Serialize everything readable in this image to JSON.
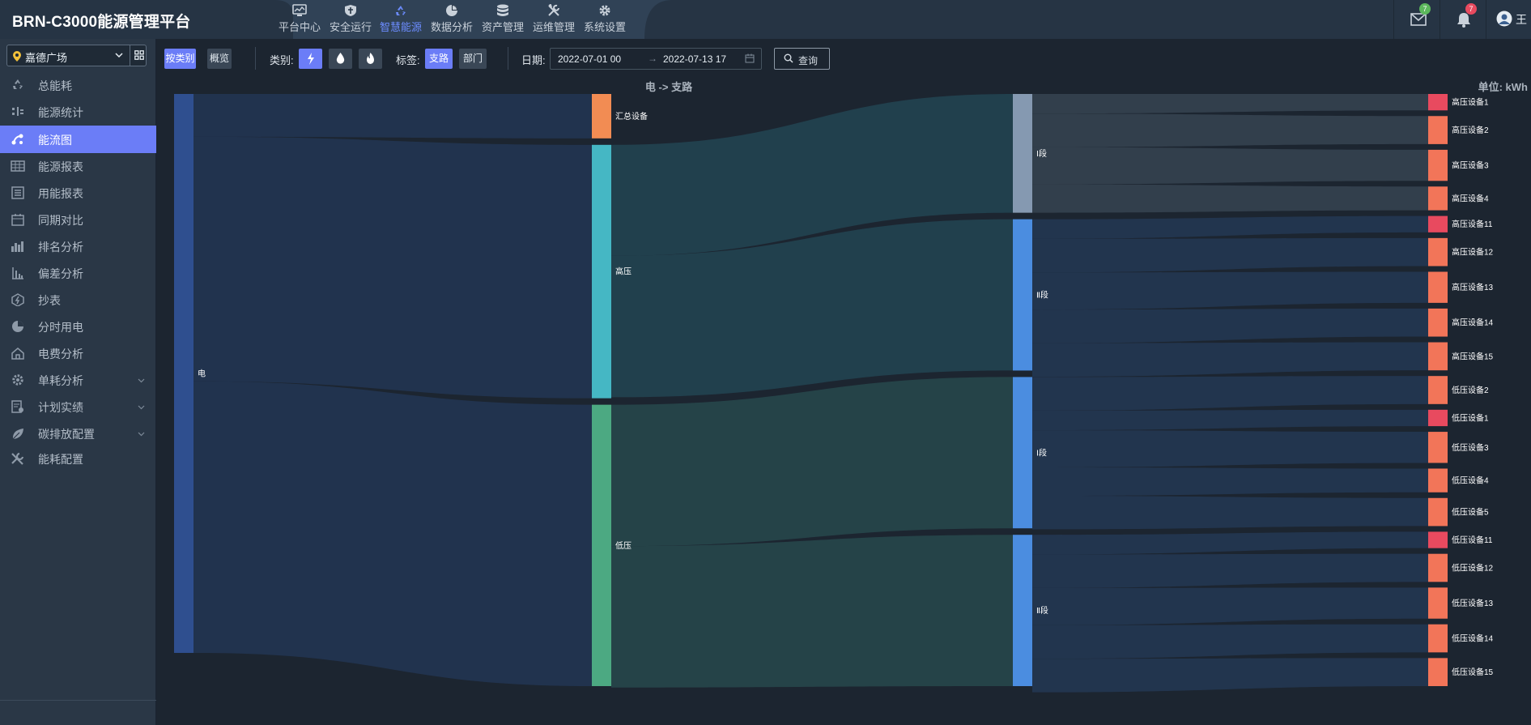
{
  "app": {
    "title": "BRN-C3000能源管理平台"
  },
  "topnav": [
    {
      "label": "平台中心",
      "icon": "monitor-icon",
      "active": false
    },
    {
      "label": "安全运行",
      "icon": "shield-icon",
      "active": false
    },
    {
      "label": "智慧能源",
      "icon": "recycle-icon",
      "active": true
    },
    {
      "label": "数据分析",
      "icon": "pie-chart-icon",
      "active": false
    },
    {
      "label": "资产管理",
      "icon": "database-icon",
      "active": false
    },
    {
      "label": "运维管理",
      "icon": "tools-icon",
      "active": false
    },
    {
      "label": "系统设置",
      "icon": "gear-icon",
      "active": false
    }
  ],
  "header_right": {
    "mail_badge": "7",
    "bell_badge": "7",
    "user_initial": "王",
    "colors": {
      "mail_badge": "#5cb85c",
      "bell_badge": "#e84a5f"
    }
  },
  "sidebar": {
    "site": "嘉德广场",
    "items": [
      {
        "label": "总能耗",
        "icon": "recycle-icon",
        "active": false,
        "expandable": false
      },
      {
        "label": "能源统计",
        "icon": "statistics-icon",
        "active": false,
        "expandable": false
      },
      {
        "label": "能流图",
        "icon": "flow-icon",
        "active": true,
        "expandable": false
      },
      {
        "label": "能源报表",
        "icon": "table-icon",
        "active": false,
        "expandable": false
      },
      {
        "label": "用能报表",
        "icon": "report-icon",
        "active": false,
        "expandable": false
      },
      {
        "label": "同期对比",
        "icon": "calendar-icon",
        "active": false,
        "expandable": false
      },
      {
        "label": "排名分析",
        "icon": "bar-chart-icon",
        "active": false,
        "expandable": false
      },
      {
        "label": "偏差分析",
        "icon": "deviation-icon",
        "active": false,
        "expandable": false
      },
      {
        "label": "抄表",
        "icon": "meter-icon",
        "active": false,
        "expandable": false
      },
      {
        "label": "分时用电",
        "icon": "clock-pie-icon",
        "active": false,
        "expandable": false
      },
      {
        "label": "电费分析",
        "icon": "house-icon",
        "active": false,
        "expandable": false
      },
      {
        "label": "单耗分析",
        "icon": "cog-icon",
        "active": false,
        "expandable": true
      },
      {
        "label": "计划实绩",
        "icon": "plan-icon",
        "active": false,
        "expandable": true
      },
      {
        "label": "碳排放配置",
        "icon": "leaf-icon",
        "active": false,
        "expandable": true
      },
      {
        "label": "能耗配置",
        "icon": "wrench-icon",
        "active": false,
        "expandable": false
      }
    ]
  },
  "toolbar": {
    "view_by_category": "按类别",
    "overview": "概览",
    "category_label": "类别:",
    "category_icons": [
      "lightning-icon",
      "water-drop-icon",
      "flame-icon"
    ],
    "tag_label": "标签:",
    "tag_branch": "支路",
    "tag_department": "部门",
    "date_label": "日期:",
    "date_start": "2022-07-01 00",
    "date_separator": "→",
    "date_end": "2022-07-13 17",
    "query": "查询"
  },
  "chart_data": {
    "type": "sankey",
    "title": "电 -> 支路",
    "unit": "单位: kWh",
    "levels": [
      [
        "电"
      ],
      [
        "汇总设备",
        "高压",
        "低压"
      ],
      [
        "Ⅰ段",
        "Ⅱ段",
        "Ⅰ段 ",
        "Ⅱ段 "
      ],
      [
        "高压设备1",
        "高压设备2",
        "高压设备3",
        "高压设备4",
        "高压设备11",
        "高压设备12",
        "高压设备13",
        "高压设备14",
        "高压设备15",
        "低压设备2",
        "低压设备1",
        "低压设备3",
        "低压设备4",
        "低压设备5",
        "低压设备11",
        "低压设备12",
        "低压设备13",
        "低压设备14",
        "低压设备15"
      ]
    ],
    "nodes": [
      {
        "name": "电",
        "level": 0,
        "value": 1200,
        "color": "#2f4f8f"
      },
      {
        "name": "汇总设备",
        "level": 1,
        "value": 92,
        "color": "#f28c53"
      },
      {
        "name": "高压",
        "level": 1,
        "value": 525,
        "color": "#45b7c4"
      },
      {
        "name": "低压",
        "level": 1,
        "value": 583,
        "color": "#4ca982"
      },
      {
        "name": "Ⅰ段",
        "level": 2,
        "value": 230,
        "color": "#8599b1"
      },
      {
        "name": "Ⅱ段",
        "level": 2,
        "value": 293,
        "color": "#4b8de0"
      },
      {
        "name": "Ⅰ段 ",
        "level": 2,
        "value": 293,
        "color": "#4b8de0"
      },
      {
        "name": "Ⅱ段 ",
        "level": 2,
        "value": 293,
        "color": "#4b8de0"
      },
      {
        "name": "高压设备1",
        "level": 3,
        "value": 38,
        "color": "#e84a5f"
      },
      {
        "name": "高压设备2",
        "level": 3,
        "value": 65,
        "color": "#f27559"
      },
      {
        "name": "高压设备3",
        "level": 3,
        "value": 72,
        "color": "#f27559"
      },
      {
        "name": "高压设备4",
        "level": 3,
        "value": 55,
        "color": "#f27559"
      },
      {
        "name": "高压设备11",
        "level": 3,
        "value": 38,
        "color": "#e84a5f"
      },
      {
        "name": "高压设备12",
        "level": 3,
        "value": 65,
        "color": "#f27559"
      },
      {
        "name": "高压设备13",
        "level": 3,
        "value": 72,
        "color": "#f27559"
      },
      {
        "name": "高压设备14",
        "level": 3,
        "value": 65,
        "color": "#f27559"
      },
      {
        "name": "高压设备15",
        "level": 3,
        "value": 65,
        "color": "#f27559"
      },
      {
        "name": "低压设备2",
        "level": 3,
        "value": 65,
        "color": "#f27559"
      },
      {
        "name": "低压设备1",
        "level": 3,
        "value": 38,
        "color": "#e84a5f"
      },
      {
        "name": "低压设备3",
        "level": 3,
        "value": 72,
        "color": "#f27559"
      },
      {
        "name": "低压设备4",
        "level": 3,
        "value": 55,
        "color": "#f27559"
      },
      {
        "name": "低压设备5",
        "level": 3,
        "value": 65,
        "color": "#f27559"
      },
      {
        "name": "低压设备11",
        "level": 3,
        "value": 38,
        "color": "#e84a5f"
      },
      {
        "name": "低压设备12",
        "level": 3,
        "value": 65,
        "color": "#f27559"
      },
      {
        "name": "低压设备13",
        "level": 3,
        "value": 72,
        "color": "#f27559"
      },
      {
        "name": "低压设备14",
        "level": 3,
        "value": 65,
        "color": "#f27559"
      },
      {
        "name": "低压设备15",
        "level": 3,
        "value": 65,
        "color": "#f27559"
      }
    ],
    "links": [
      {
        "source": "电",
        "target": "汇总设备",
        "value": 92
      },
      {
        "source": "电",
        "target": "高压",
        "value": 525
      },
      {
        "source": "电",
        "target": "低压",
        "value": 583
      },
      {
        "source": "高压",
        "target": "Ⅰ段",
        "value": 230
      },
      {
        "source": "高压",
        "target": "Ⅱ段",
        "value": 293
      },
      {
        "source": "低压",
        "target": "Ⅰ段 ",
        "value": 293
      },
      {
        "source": "低压",
        "target": "Ⅱ段 ",
        "value": 293
      },
      {
        "source": "Ⅰ段",
        "target": "高压设备1",
        "value": 38
      },
      {
        "source": "Ⅰ段",
        "target": "高压设备2",
        "value": 65
      },
      {
        "source": "Ⅰ段",
        "target": "高压设备3",
        "value": 72
      },
      {
        "source": "Ⅰ段",
        "target": "高压设备4",
        "value": 55
      },
      {
        "source": "Ⅱ段",
        "target": "高压设备11",
        "value": 38
      },
      {
        "source": "Ⅱ段",
        "target": "高压设备12",
        "value": 65
      },
      {
        "source": "Ⅱ段",
        "target": "高压设备13",
        "value": 72
      },
      {
        "source": "Ⅱ段",
        "target": "高压设备14",
        "value": 65
      },
      {
        "source": "Ⅱ段",
        "target": "高压设备15",
        "value": 65
      },
      {
        "source": "Ⅰ段 ",
        "target": "低压设备2",
        "value": 65
      },
      {
        "source": "Ⅰ段 ",
        "target": "低压设备1",
        "value": 38
      },
      {
        "source": "Ⅰ段 ",
        "target": "低压设备3",
        "value": 72
      },
      {
        "source": "Ⅰ段 ",
        "target": "低压设备4",
        "value": 55
      },
      {
        "source": "Ⅰ段 ",
        "target": "低压设备5",
        "value": 65
      },
      {
        "source": "Ⅱ段 ",
        "target": "低压设备11",
        "value": 38
      },
      {
        "source": "Ⅱ段 ",
        "target": "低压设备12",
        "value": 65
      },
      {
        "source": "Ⅱ段 ",
        "target": "低压设备13",
        "value": 72
      },
      {
        "source": "Ⅱ段 ",
        "target": "低压设备14",
        "value": 65
      },
      {
        "source": "Ⅱ段 ",
        "target": "低压设备15",
        "value": 65
      }
    ]
  }
}
